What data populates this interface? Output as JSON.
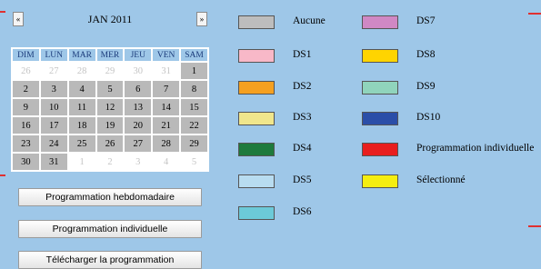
{
  "calendar": {
    "prev_label": "«",
    "next_label": "»",
    "title": "JAN 2011",
    "weekdays": [
      "DIM",
      "LUN",
      "MAR",
      "MER",
      "JEU",
      "VEN",
      "SAM"
    ],
    "weeks": [
      [
        {
          "d": "26",
          "o": true
        },
        {
          "d": "27",
          "o": true
        },
        {
          "d": "28",
          "o": true
        },
        {
          "d": "29",
          "o": true
        },
        {
          "d": "30",
          "o": true
        },
        {
          "d": "31",
          "o": true
        },
        {
          "d": "1",
          "o": false
        }
      ],
      [
        {
          "d": "2",
          "o": false
        },
        {
          "d": "3",
          "o": false
        },
        {
          "d": "4",
          "o": false
        },
        {
          "d": "5",
          "o": false
        },
        {
          "d": "6",
          "o": false
        },
        {
          "d": "7",
          "o": false
        },
        {
          "d": "8",
          "o": false
        }
      ],
      [
        {
          "d": "9",
          "o": false
        },
        {
          "d": "10",
          "o": false
        },
        {
          "d": "11",
          "o": false
        },
        {
          "d": "12",
          "o": false
        },
        {
          "d": "13",
          "o": false
        },
        {
          "d": "14",
          "o": false
        },
        {
          "d": "15",
          "o": false
        }
      ],
      [
        {
          "d": "16",
          "o": false
        },
        {
          "d": "17",
          "o": false
        },
        {
          "d": "18",
          "o": false
        },
        {
          "d": "19",
          "o": false
        },
        {
          "d": "20",
          "o": false
        },
        {
          "d": "21",
          "o": false
        },
        {
          "d": "22",
          "o": false
        }
      ],
      [
        {
          "d": "23",
          "o": false
        },
        {
          "d": "24",
          "o": false
        },
        {
          "d": "25",
          "o": false
        },
        {
          "d": "26",
          "o": false
        },
        {
          "d": "27",
          "o": false
        },
        {
          "d": "28",
          "o": false
        },
        {
          "d": "29",
          "o": false
        }
      ],
      [
        {
          "d": "30",
          "o": false
        },
        {
          "d": "31",
          "o": false
        },
        {
          "d": "1",
          "o": true
        },
        {
          "d": "2",
          "o": true
        },
        {
          "d": "3",
          "o": true
        },
        {
          "d": "4",
          "o": true
        },
        {
          "d": "5",
          "o": true
        }
      ]
    ]
  },
  "actions": {
    "weekly": "Programmation hebdomadaire",
    "individual": "Programmation individuelle",
    "download": "Télécharger la programmation"
  },
  "legend": [
    {
      "label": "Aucune",
      "color": "#bdbdbd"
    },
    {
      "label": "DS1",
      "color": "#f8b8c8"
    },
    {
      "label": "DS2",
      "color": "#f5a020"
    },
    {
      "label": "DS3",
      "color": "#f0e68c"
    },
    {
      "label": "DS4",
      "color": "#1e7a3c"
    },
    {
      "label": "DS5",
      "color": "#b8dcf0"
    },
    {
      "label": "DS6",
      "color": "#6ccad8"
    },
    {
      "label": "DS7",
      "color": "#d088c4"
    },
    {
      "label": "DS8",
      "color": "#ffd400"
    },
    {
      "label": "DS9",
      "color": "#90d4bc"
    },
    {
      "label": "DS10",
      "color": "#2b4ea8"
    },
    {
      "label": "Programmation individuelle",
      "color": "#e81e1e"
    },
    {
      "label": "Sélectionné",
      "color": "#f5ee10"
    }
  ]
}
